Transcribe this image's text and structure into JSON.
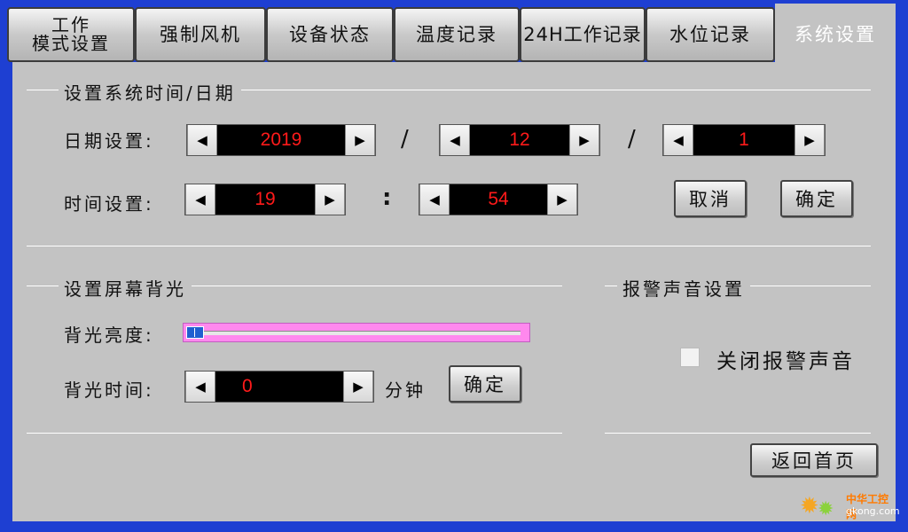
{
  "tabs": [
    {
      "label": "工作\n模式设置"
    },
    {
      "label": "强制风机"
    },
    {
      "label": "设备状态"
    },
    {
      "label": "温度记录"
    },
    {
      "label": "24H工作记录"
    },
    {
      "label": "水位记录"
    },
    {
      "label": "系统设置"
    }
  ],
  "datetime": {
    "section_title": "设置系统时间/日期",
    "date_label": "日期设置:",
    "year": "2019",
    "month": "12",
    "day": "1",
    "date_sep": "/",
    "time_label": "时间设置:",
    "hour": "19",
    "minute": "54",
    "time_sep": ":",
    "cancel_label": "取消",
    "confirm_label": "确定"
  },
  "backlight": {
    "section_title": "设置屏幕背光",
    "brightness_label": "背光亮度:",
    "brightness_level": 0.03,
    "time_label": "背光时间:",
    "time_value": "0",
    "time_unit": "分钟",
    "confirm_label": "确定"
  },
  "alarm": {
    "section_title": "报警声音设置",
    "mute_label": "关闭报警声音",
    "mute_checked": false
  },
  "home_button_label": "返回首页",
  "watermark": {
    "line1": "中华工控网",
    "line2": "gkong.com"
  },
  "icons": {
    "left_arrow": "◀",
    "right_arrow": "▶"
  },
  "colors": {
    "frame": "#1e3fd2",
    "panel": "#c3c3c3",
    "value_text": "#ff1a1a",
    "slider": "#ff88ee"
  }
}
